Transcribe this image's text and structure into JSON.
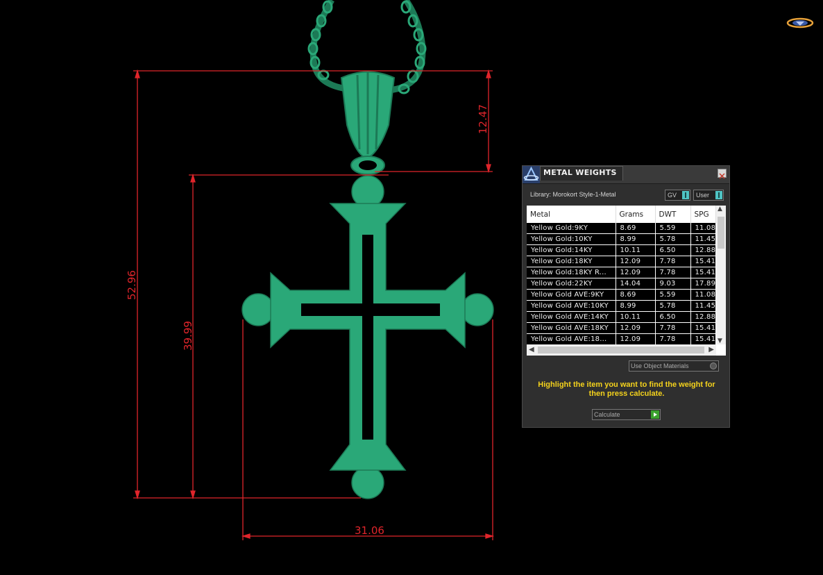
{
  "dimensions": {
    "overall_height": "52.96",
    "cross_height": "39.99",
    "bail_height": "12.47",
    "width": "31.06"
  },
  "panel": {
    "title": "METAL WEIGHTS",
    "library": "Library: Morokort Style-1-Metal",
    "toggle_gv": "GV",
    "toggle_user": "User",
    "columns": [
      "Metal",
      "Grams",
      "DWT",
      "SPG"
    ],
    "rows": [
      [
        "Yellow Gold:9KY",
        "8.69",
        "5.59",
        "11.08"
      ],
      [
        "Yellow Gold:10KY",
        "8.99",
        "5.78",
        "11.45"
      ],
      [
        "Yellow Gold:14KY",
        "10.11",
        "6.50",
        "12.88"
      ],
      [
        "Yellow Gold:18KY",
        "12.09",
        "7.78",
        "15.41"
      ],
      [
        "Yellow Gold:18KY R...",
        "12.09",
        "7.78",
        "15.41"
      ],
      [
        "Yellow Gold:22KY",
        "14.04",
        "9.03",
        "17.89"
      ],
      [
        "Yellow Gold AVE:9KY",
        "8.69",
        "5.59",
        "11.08"
      ],
      [
        "Yellow Gold AVE:10KY",
        "8.99",
        "5.78",
        "11.45"
      ],
      [
        "Yellow Gold AVE:14KY",
        "10.11",
        "6.50",
        "12.88"
      ],
      [
        "Yellow Gold AVE:18KY",
        "12.09",
        "7.78",
        "15.41"
      ],
      [
        "Yellow Gold AVE:18...",
        "12.09",
        "7.78",
        "15.41"
      ]
    ],
    "materials_select": "Use Object Materials",
    "instructions": "Highlight the item you want to find the weight for then press calculate.",
    "calculate_label": "Calculate"
  },
  "colors": {
    "model": "#2aa878",
    "dimension_lines": "#e0252b",
    "instruction_text": "#f4d21c"
  }
}
